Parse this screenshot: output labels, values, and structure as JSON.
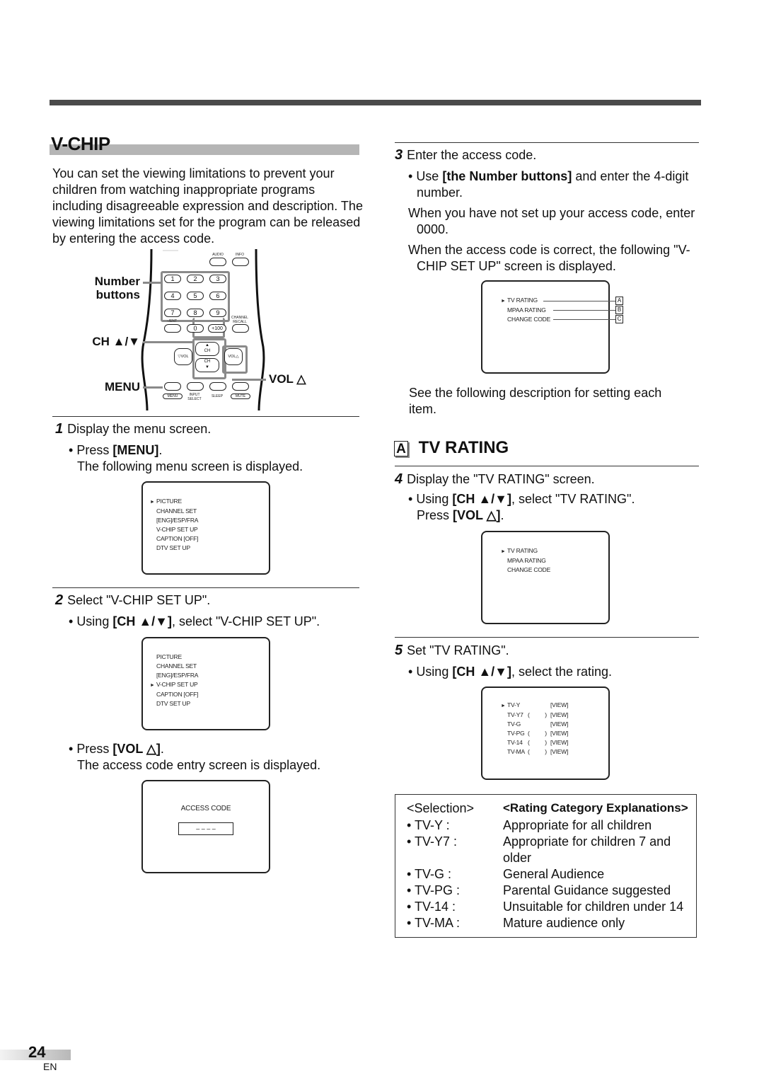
{
  "section": {
    "title": "V-CHIP",
    "intro": "You can set the viewing limitations to prevent your children from watching inappropriate programs including disagreeable expression and description. The viewing limitations set for the program can be released by entering the access code."
  },
  "remote": {
    "labels": {
      "number_buttons_1": "Number",
      "number_buttons_2": "buttons",
      "ch": "CH ▲/▼",
      "menu": "MENU",
      "vol": "VOL △"
    },
    "buttons": {
      "audio": "AUDIO",
      "info": "INFO",
      "digits": [
        "1",
        "2",
        "3",
        "4",
        "5",
        "6",
        "7",
        "8",
        "9"
      ],
      "ent": "–/ENT",
      "zero": "0",
      "plus100": "+100",
      "channel_recall_1": "CHANNEL",
      "channel_recall_2": "RECALL",
      "ch_up": "CH",
      "ch_down": "CH",
      "vol_down": "VOL",
      "vol_up": "VOL",
      "menu": "MENU",
      "input_select_1": "INPUT",
      "input_select_2": "SELECT",
      "sleep": "SLEEP",
      "mute": "MUTE"
    }
  },
  "steps": {
    "s1": {
      "num": "1",
      "title": "Display the menu screen.",
      "bullet_pre": "Press ",
      "bullet_bold": "[MENU]",
      "bullet_post": ".",
      "note": "The following menu screen is displayed."
    },
    "s2": {
      "num": "2",
      "title": "Select \"V-CHIP SET UP\".",
      "bullet_pre": "Using ",
      "bullet_bold": "[CH ▲/▼]",
      "bullet_post": ", select \"V-CHIP SET UP\".",
      "bullet2_pre": "Press ",
      "bullet2_bold": "[VOL △]",
      "bullet2_post": ".",
      "note": "The access code entry screen is displayed."
    },
    "s3": {
      "num": "3",
      "title": "Enter the access code.",
      "b1_pre": "Use ",
      "b1_bold": "[the Number buttons]",
      "b1_post": " and enter the 4-digit number.",
      "b2": "When you have not set up your access code, enter 0000.",
      "b3": "When the access code is correct, the following \"V-CHIP SET UP\" screen is displayed.",
      "note": "See the following description for setting each item."
    },
    "s4": {
      "num": "4",
      "title": "Display the \"TV RATING\" screen.",
      "b1_pre": "Using ",
      "b1_bold": "[CH ▲/▼]",
      "b1_post": ", select \"TV RATING\".",
      "b1_line2_pre": "Press ",
      "b1_line2_bold": "[VOL △]",
      "b1_line2_post": "."
    },
    "s5": {
      "num": "5",
      "title": "Set \"TV RATING\".",
      "b1_pre": "Using ",
      "b1_bold": "[CH ▲/▼]",
      "b1_post": ", select the rating."
    }
  },
  "screens": {
    "menu": {
      "items": [
        "PICTURE",
        "CHANNEL SET",
        "[ENG]/ESP/FRA",
        "V-CHIP SET UP",
        "CAPTION [OFF]",
        "DTV SET UP"
      ],
      "selected_first": "PICTURE",
      "selected_second": "V-CHIP SET UP"
    },
    "access": {
      "label": "ACCESS CODE",
      "placeholder": "– – – –"
    },
    "vchip": {
      "items": [
        "TV RATING",
        "MPAA RATING",
        "CHANGE CODE"
      ],
      "callouts": [
        "A",
        "B",
        "C"
      ],
      "selected": "TV RATING"
    },
    "ratings": {
      "rows": [
        {
          "name": "TV-Y",
          "paren": "",
          "view": "[VIEW]"
        },
        {
          "name": "TV-Y7",
          "paren": "(          )",
          "view": "[VIEW]"
        },
        {
          "name": "TV-G",
          "paren": "",
          "view": "[VIEW]"
        },
        {
          "name": "TV-PG",
          "paren": "(          )",
          "view": "[VIEW]"
        },
        {
          "name": "TV-14",
          "paren": "(          )",
          "view": "[VIEW]"
        },
        {
          "name": "TV-MA",
          "paren": "(          )",
          "view": "[VIEW]"
        }
      ],
      "selected": "TV-Y"
    }
  },
  "tv_rating": {
    "badge": "A",
    "title": "TV RATING"
  },
  "rating_table": {
    "header_selection": "<Selection>",
    "header_explanation": "<Rating Category Explanations>",
    "rows": [
      {
        "sel": "• TV-Y :",
        "exp": "Appropriate for all children"
      },
      {
        "sel": "• TV-Y7 :",
        "exp": "Appropriate for children 7 and"
      },
      {
        "sel": "",
        "exp": "older"
      },
      {
        "sel": "• TV-G :",
        "exp": "General Audience"
      },
      {
        "sel": "• TV-PG :",
        "exp": "Parental Guidance suggested"
      },
      {
        "sel": "• TV-14 :",
        "exp": "Unsuitable for children under 14"
      },
      {
        "sel": "• TV-MA :",
        "exp": "Mature audience only"
      }
    ]
  },
  "footer": {
    "page": "24",
    "lang": "EN"
  }
}
